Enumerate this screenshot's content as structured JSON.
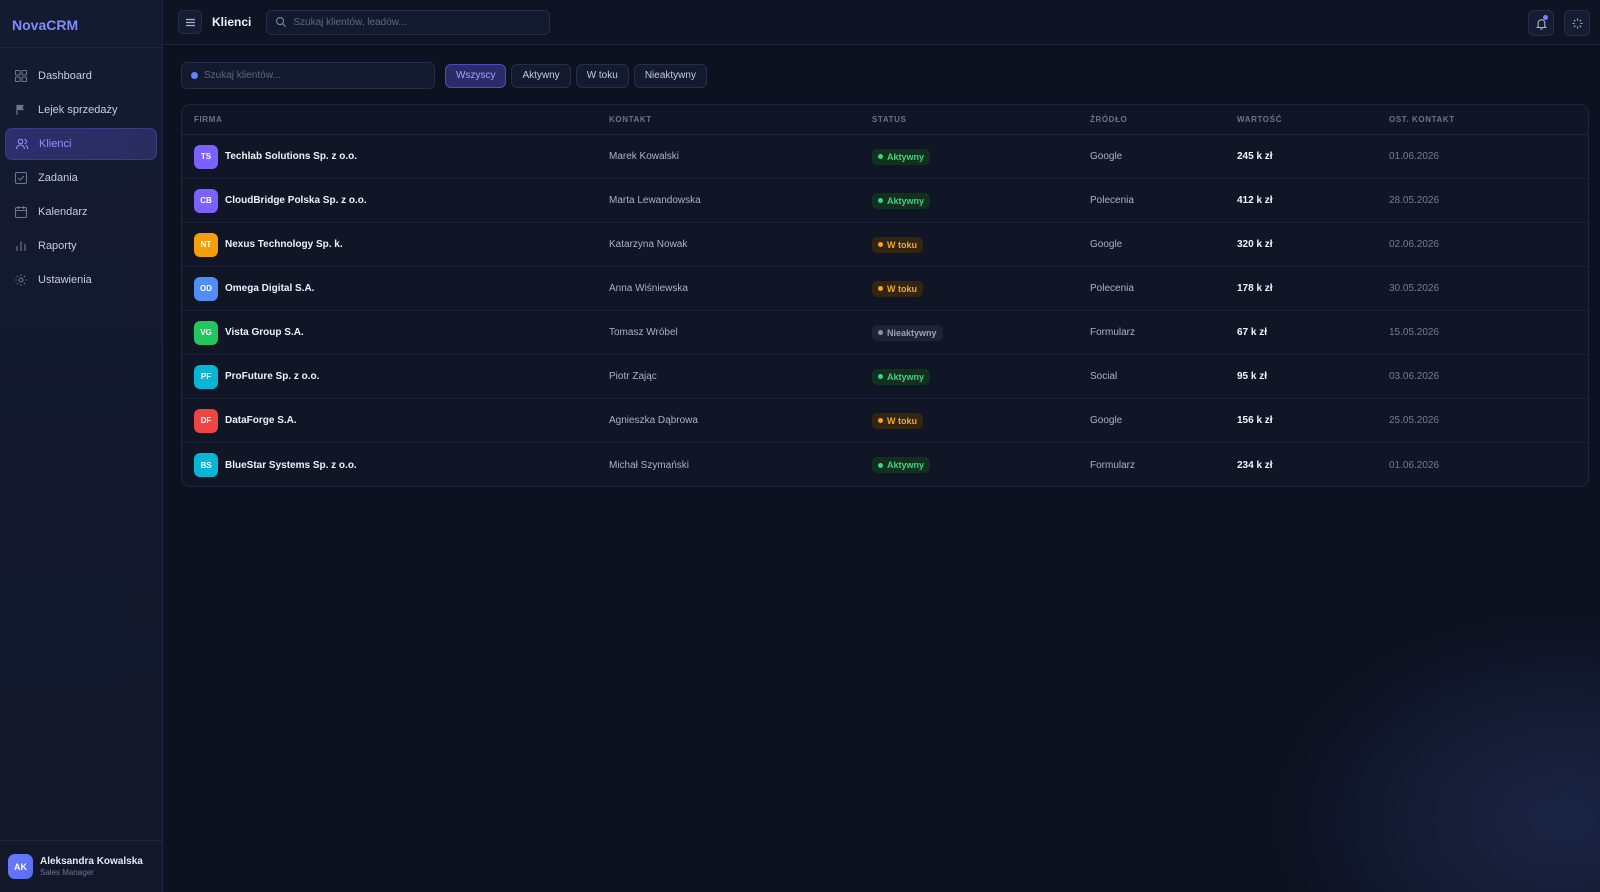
{
  "brand": "NovaCRM",
  "sidebar": {
    "items": [
      {
        "label": "Dashboard",
        "icon": "grid-icon"
      },
      {
        "label": "Lejek sprzedaży",
        "icon": "flag-icon"
      },
      {
        "label": "Klienci",
        "icon": "users-icon",
        "active": true
      },
      {
        "label": "Zadania",
        "icon": "checkbox-icon"
      },
      {
        "label": "Kalendarz",
        "icon": "calendar-icon"
      },
      {
        "label": "Raporty",
        "icon": "bar-chart-icon"
      },
      {
        "label": "Ustawienia",
        "icon": "gear-icon"
      }
    ]
  },
  "user": {
    "initials": "AK",
    "name": "Aleksandra Kowalska",
    "role": "Sales Manager"
  },
  "topbar": {
    "title": "Klienci",
    "search_placeholder": "Szukaj klientów, leadów..."
  },
  "filters": {
    "search_placeholder": "Szukaj klientów...",
    "chips": [
      "Wszyscy",
      "Aktywny",
      "W toku",
      "Nieaktywny"
    ],
    "active_chip": "Wszyscy"
  },
  "table": {
    "headers": {
      "firma": "FIRMA",
      "kontakt": "KONTAKT",
      "status": "STATUS",
      "zrodlo": "ŹRÓDŁO",
      "wartosc": "WARTOŚĆ",
      "ost": "OST. KONTAKT"
    },
    "rows": [
      {
        "initials": "TS",
        "color": "#7b61ff",
        "firma": "Techlab Solutions Sp. z o.o.",
        "kontakt": "Marek Kowalski",
        "status": "Aktywny",
        "status_kind": "aktywny",
        "zrodlo": "Google",
        "wartosc": "245 k zł",
        "ost": "01.06.2026"
      },
      {
        "initials": "CB",
        "color": "#7b61ff",
        "firma": "CloudBridge Polska Sp. z o.o.",
        "kontakt": "Marta Lewandowska",
        "status": "Aktywny",
        "status_kind": "aktywny",
        "zrodlo": "Polecenia",
        "wartosc": "412 k zł",
        "ost": "28.05.2026"
      },
      {
        "initials": "NT",
        "color": "#f59e0b",
        "firma": "Nexus Technology Sp. k.",
        "kontakt": "Katarzyna Nowak",
        "status": "W toku",
        "status_kind": "wtoku",
        "zrodlo": "Google",
        "wartosc": "320 k zł",
        "ost": "02.06.2026"
      },
      {
        "initials": "OD",
        "color": "#4f8df7",
        "firma": "Omega Digital S.A.",
        "kontakt": "Anna Wiśniewska",
        "status": "W toku",
        "status_kind": "wtoku",
        "zrodlo": "Polecenia",
        "wartosc": "178 k zł",
        "ost": "30.05.2026"
      },
      {
        "initials": "VG",
        "color": "#22c55e",
        "firma": "Vista Group S.A.",
        "kontakt": "Tomasz Wróbel",
        "status": "Nieaktywny",
        "status_kind": "nieaktywny",
        "zrodlo": "Formularz",
        "wartosc": "67 k zł",
        "ost": "15.05.2026"
      },
      {
        "initials": "PF",
        "color": "#06b6d4",
        "firma": "ProFuture Sp. z o.o.",
        "kontakt": "Piotr Zając",
        "status": "Aktywny",
        "status_kind": "aktywny",
        "zrodlo": "Social",
        "wartosc": "95 k zł",
        "ost": "03.06.2026"
      },
      {
        "initials": "DF",
        "color": "#ef4444",
        "firma": "DataForge S.A.",
        "kontakt": "Agnieszka Dąbrowa",
        "status": "W toku",
        "status_kind": "wtoku",
        "zrodlo": "Google",
        "wartosc": "156 k zł",
        "ost": "25.05.2026"
      },
      {
        "initials": "BS",
        "color": "#06b6d4",
        "firma": "BlueStar Systems Sp. z o.o.",
        "kontakt": "Michał Szymański",
        "status": "Aktywny",
        "status_kind": "aktywny",
        "zrodlo": "Formularz",
        "wartosc": "234 k zł",
        "ost": "01.06.2026"
      }
    ]
  }
}
